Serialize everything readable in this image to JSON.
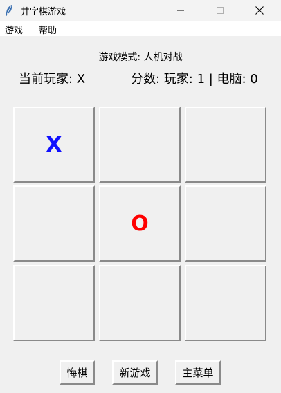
{
  "window": {
    "title": "井字棋游戏",
    "icon": "feather-icon"
  },
  "menu": {
    "game": "游戏",
    "help": "帮助"
  },
  "status": {
    "mode": "游戏模式: 人机对战",
    "current_player": "当前玩家: X",
    "score": "分数: 玩家: 1 | 电脑: 0"
  },
  "board": {
    "cells": [
      "",
      "",
      "",
      "",
      "",
      "",
      "",
      "",
      ""
    ],
    "marks": [
      "X",
      "",
      "",
      "",
      "O",
      "",
      "",
      "",
      ""
    ],
    "colors": {
      "X": "#1010ff",
      "O": "#ff0000"
    }
  },
  "buttons": {
    "undo": "悔棋",
    "new_game": "新游戏",
    "main_menu": "主菜单"
  }
}
